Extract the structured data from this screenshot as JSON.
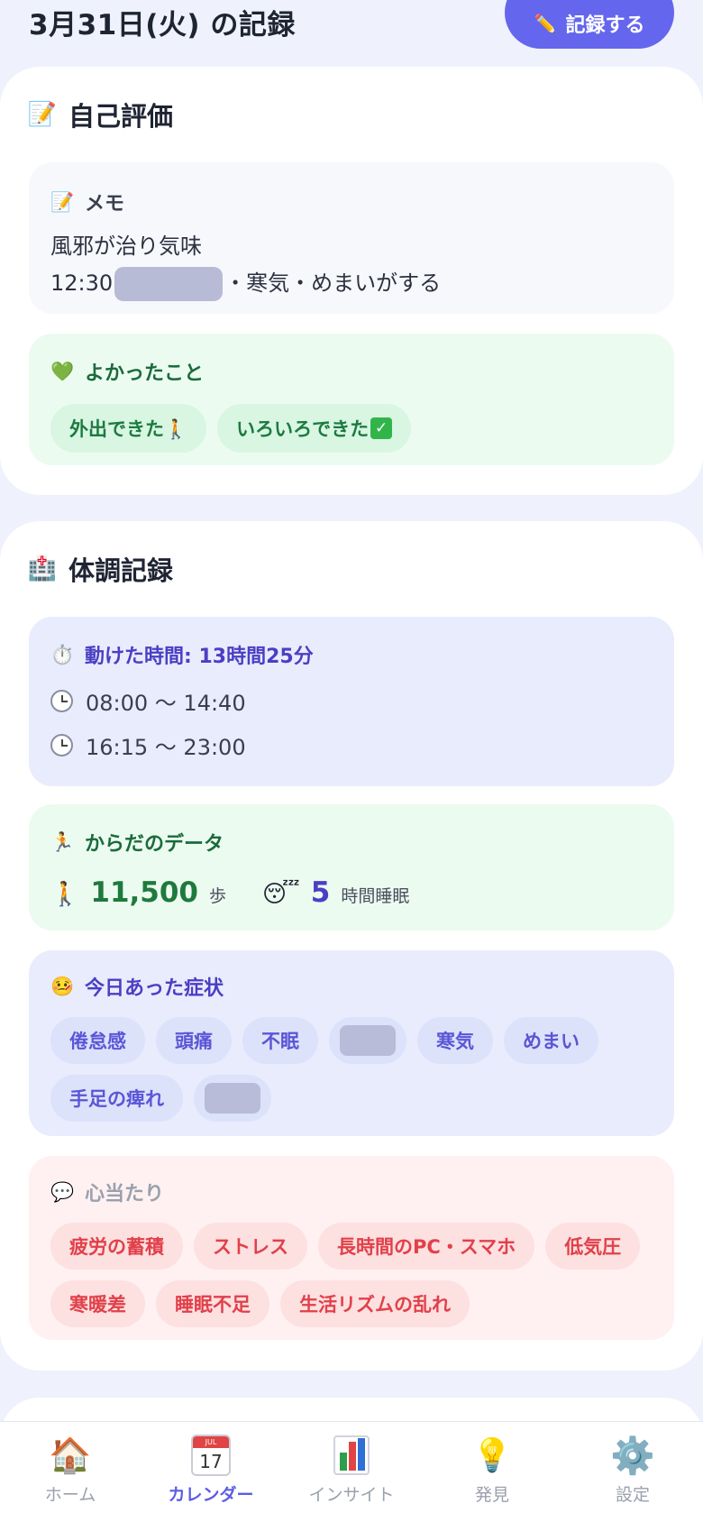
{
  "header": {
    "title": "3月31日(火) の記録",
    "record_button": "記録する",
    "record_button_icon": "pencil-icon"
  },
  "self_eval": {
    "title": "自己評価",
    "icon": "memo-icon",
    "memo": {
      "label": "メモ",
      "line1": "風邪が治り気味",
      "line2_prefix": "12:30",
      "line2_suffix": "・寒気・めまいがする"
    },
    "good": {
      "label": "よかったこと",
      "icon": "green-heart-icon",
      "items": [
        "外出できた🚶",
        "いろいろできた"
      ]
    }
  },
  "health": {
    "title": "体調記録",
    "icon": "hospital-icon",
    "active": {
      "label": "動けた時間: 13時間25分",
      "icon": "stopwatch-icon",
      "ranges": [
        "08:00 〜 14:40",
        "16:15 〜 23:00"
      ]
    },
    "body": {
      "label": "からだのデータ",
      "icon": "runner-icon",
      "steps": "11,500",
      "steps_unit": "歩",
      "sleep": "5",
      "sleep_unit": "時間睡眠"
    },
    "symptoms": {
      "label": "今日あった症状",
      "icon": "feverish-face-icon",
      "items": [
        "倦怠感",
        "頭痛",
        "不眠",
        "寒気",
        "めまい",
        "手足の痺れ"
      ]
    },
    "causes": {
      "label": "心当たり",
      "icon": "speech-bubble-icon",
      "items": [
        "疲労の蓄積",
        "ストレス",
        "長時間のPC・スマホ",
        "低気圧",
        "寒暖差",
        "睡眠不足",
        "生活リズムの乱れ"
      ]
    }
  },
  "nav": {
    "items": [
      {
        "label": "ホーム",
        "icon": "house-icon"
      },
      {
        "label": "カレンダー",
        "icon": "calendar-icon"
      },
      {
        "label": "インサイト",
        "icon": "bar-chart-icon"
      },
      {
        "label": "発見",
        "icon": "lightbulb-icon"
      },
      {
        "label": "設定",
        "icon": "gear-icon"
      }
    ],
    "calendar_icon_day": "17",
    "calendar_icon_month": "JUL",
    "active": "カレンダー"
  },
  "colors": {
    "accent": "#6466ee",
    "green": "#1d7a40",
    "purple": "#4a3fc4",
    "red": "#e1404a"
  }
}
